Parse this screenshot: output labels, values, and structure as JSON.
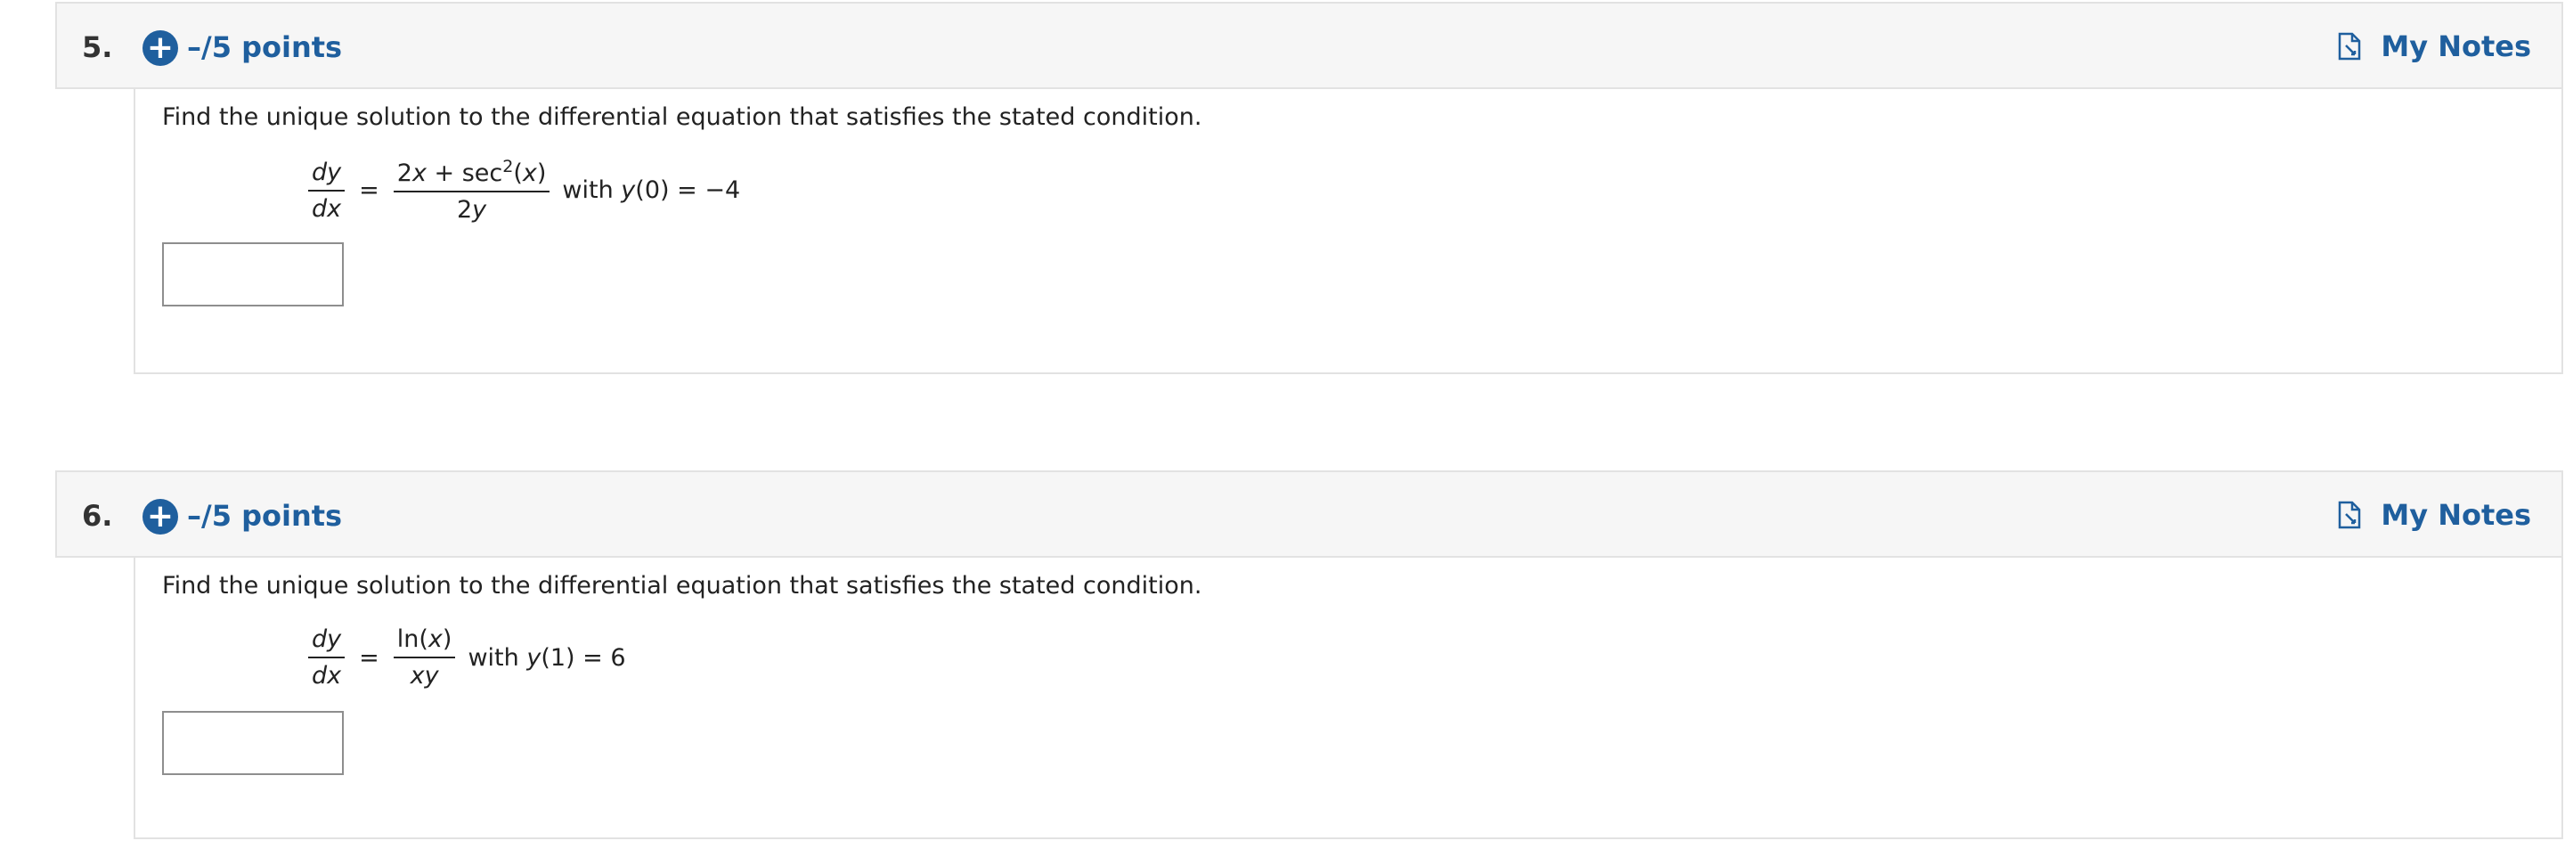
{
  "questions": [
    {
      "number": "5.",
      "points": "–/5 points",
      "notes_label": "My Notes",
      "prompt": "Find the unique solution to the differential equation that satisfies the stated condition.",
      "lhs_num": "dy",
      "lhs_den": "dx",
      "rhs_num_pre": "2",
      "rhs_num_x": "x",
      "rhs_num_mid": " + sec",
      "rhs_num_exp": "2",
      "rhs_num_post": "(",
      "rhs_num_x2": "x",
      "rhs_num_close": ")",
      "rhs_den_pre": "2",
      "rhs_den_var": "y",
      "condition_with": "with",
      "condition_y": "y",
      "condition_arg": "(0)",
      "condition_eq": "=",
      "condition_val": "−4",
      "answer_value": ""
    },
    {
      "number": "6.",
      "points": "–/5 points",
      "notes_label": "My Notes",
      "prompt": "Find the unique solution to the differential equation that satisfies the stated condition.",
      "lhs_num": "dy",
      "lhs_den": "dx",
      "rhs_num_pre": "ln(",
      "rhs_num_x": "x",
      "rhs_num_close": ")",
      "rhs_den": "xy",
      "condition_with": "with",
      "condition_y": "y",
      "condition_arg": "(1)",
      "condition_eq": "=",
      "condition_val": "6",
      "answer_value": ""
    }
  ],
  "icons": {
    "add": "plus-circle-icon",
    "notes": "note-document-icon"
  },
  "colors": {
    "accent": "#1f5f9e",
    "header_bg": "#f6f6f6",
    "border": "#e2e2e2"
  }
}
